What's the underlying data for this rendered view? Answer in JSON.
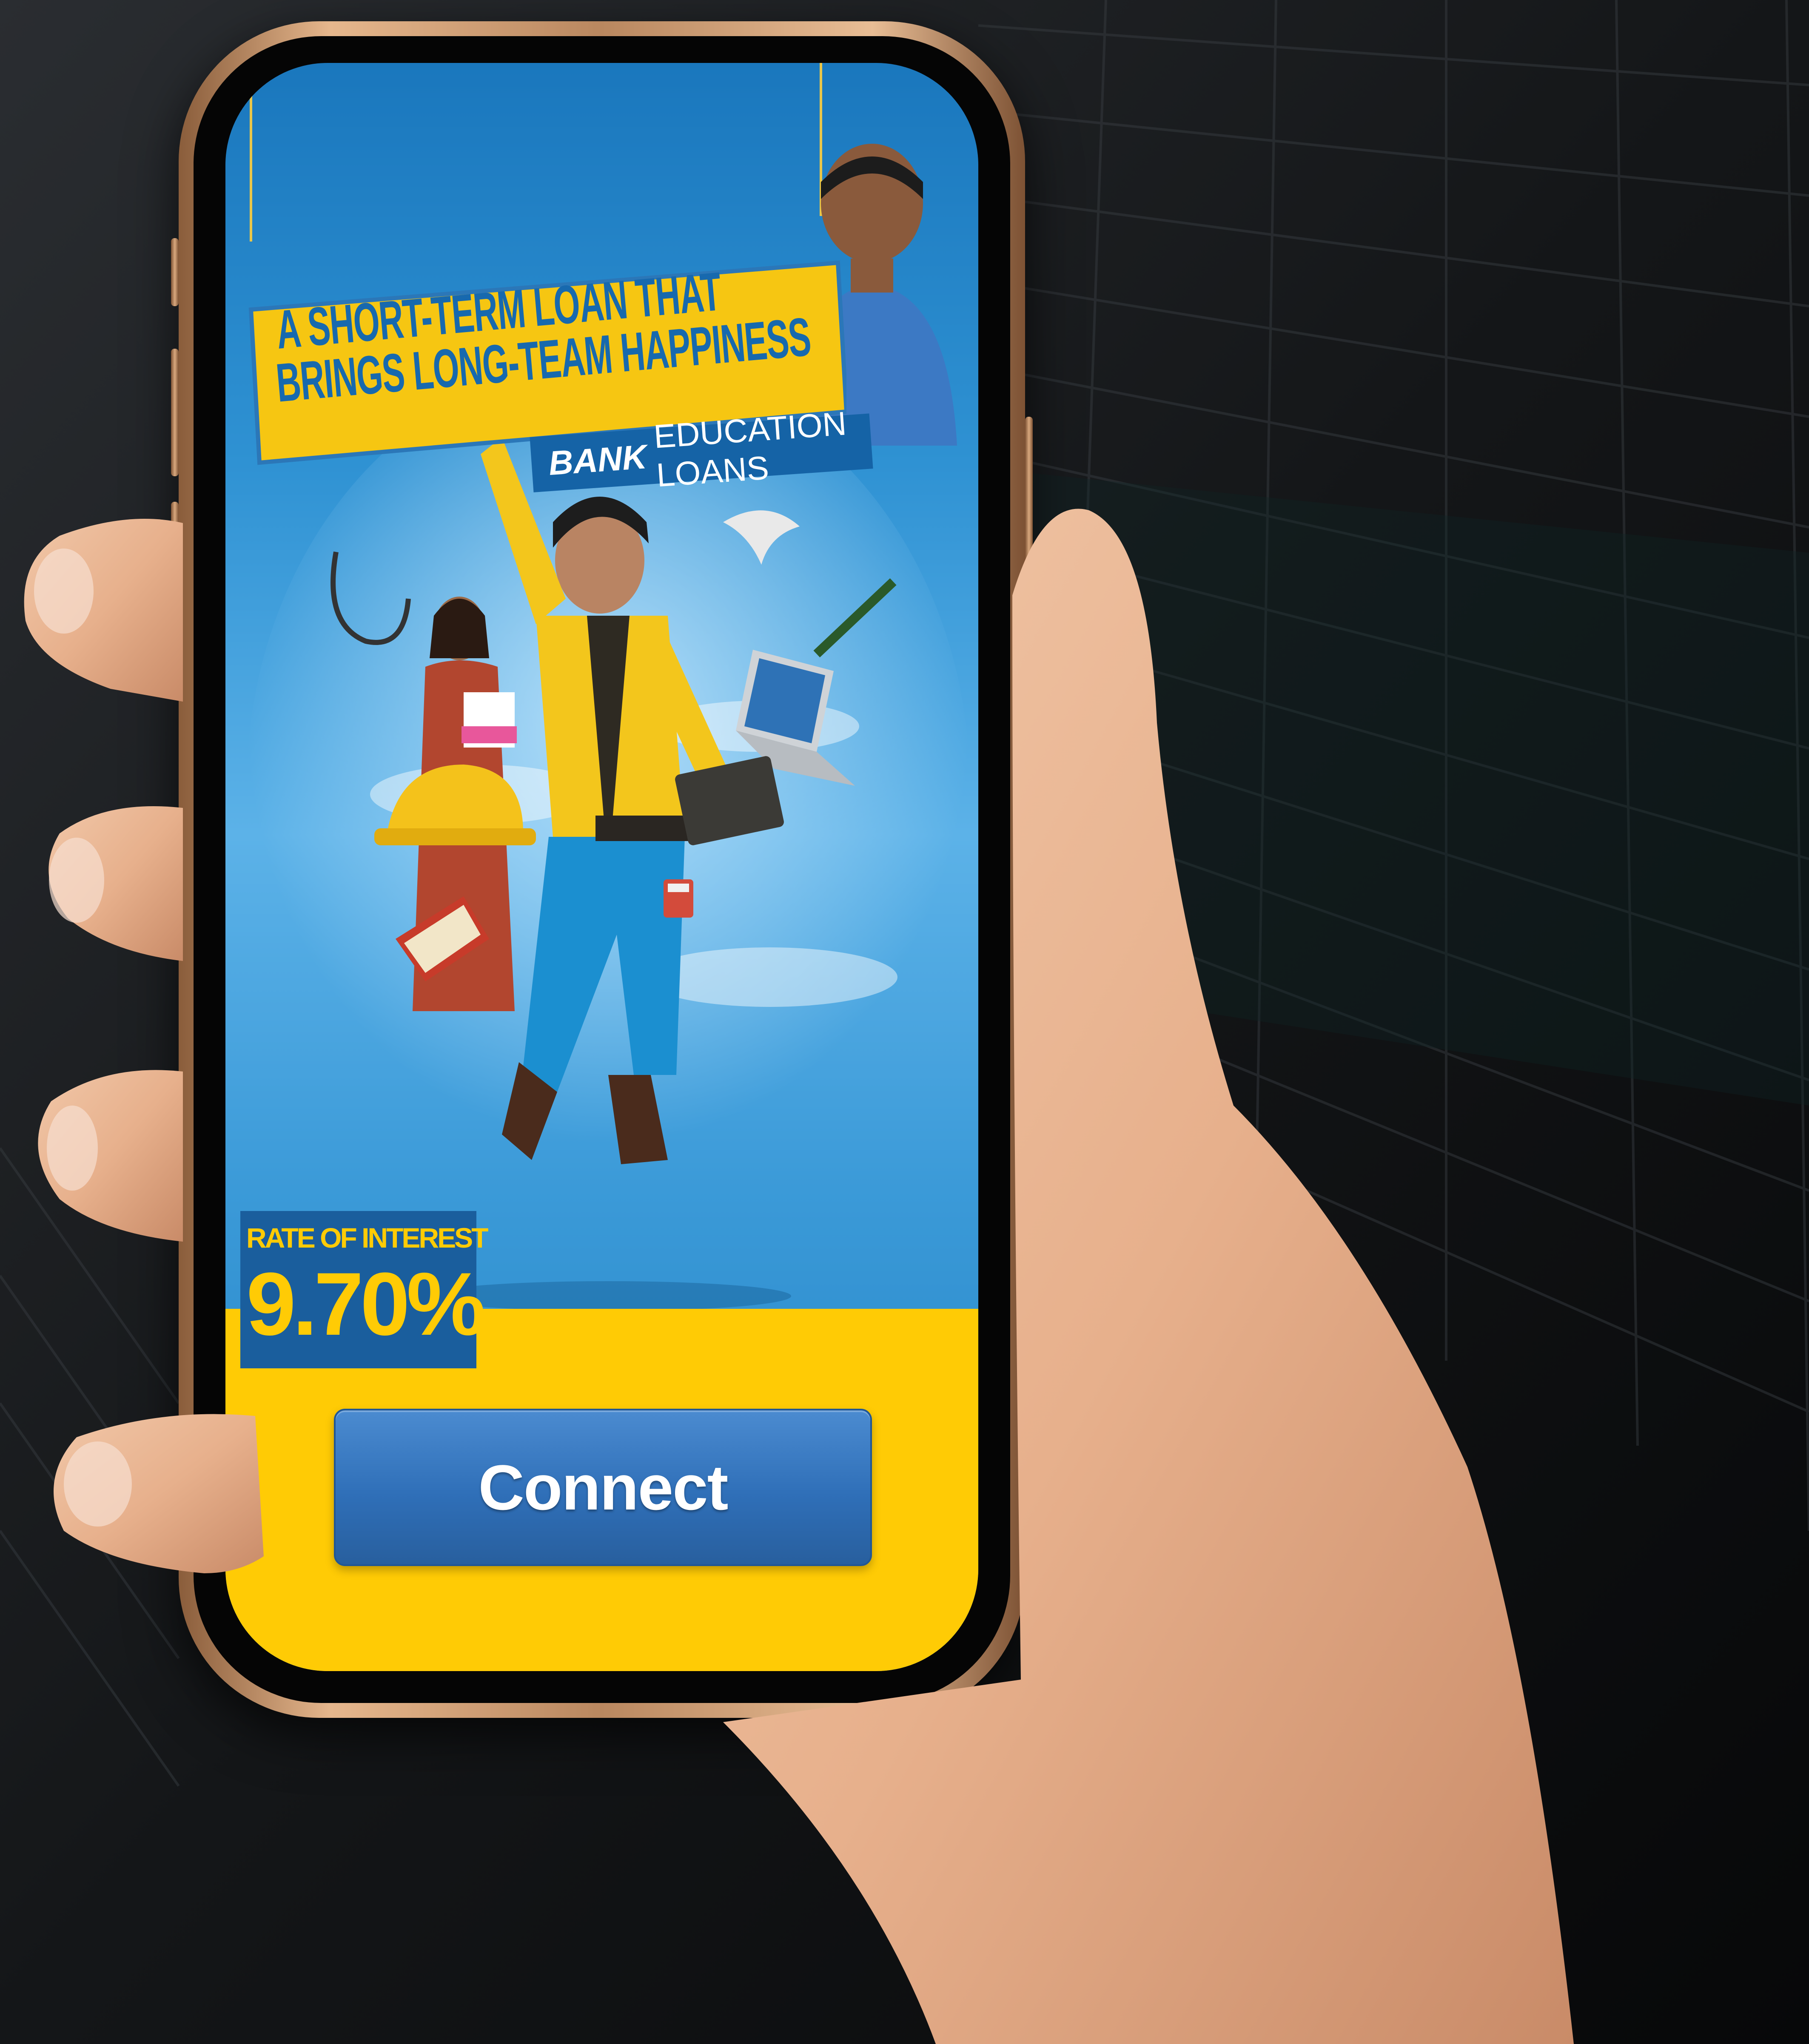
{
  "ad": {
    "headline_line_1": "A SHORT-TERM LOAN THAT",
    "headline_line_2": "BRINGS LONG-TEAM HAPPINESS",
    "brand_bold": "BANK",
    "brand_rest": "EDUCATION LOANS"
  },
  "rate": {
    "label": "RATE OF INTEREST",
    "value": "9.70%"
  },
  "actions": {
    "connect_label": "Connect"
  },
  "colors": {
    "brand_blue": "#1769ae",
    "accent_yellow": "#ffcb05",
    "button_blue": "#2f6fb8"
  }
}
